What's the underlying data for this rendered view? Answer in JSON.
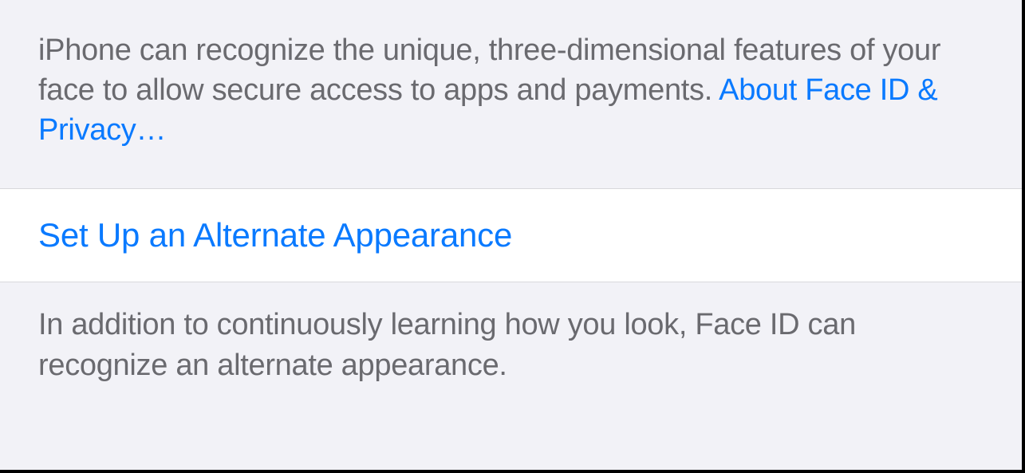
{
  "header": {
    "description": "iPhone can recognize the unique, three-dimensional features of your face to allow secure access to apps and payments. ",
    "link": "About Face ID & Privacy…"
  },
  "action": {
    "label": "Set Up an Alternate Appearance"
  },
  "footer": {
    "description": "In addition to continuously learning how you look, Face ID can recognize an alternate appearance."
  }
}
